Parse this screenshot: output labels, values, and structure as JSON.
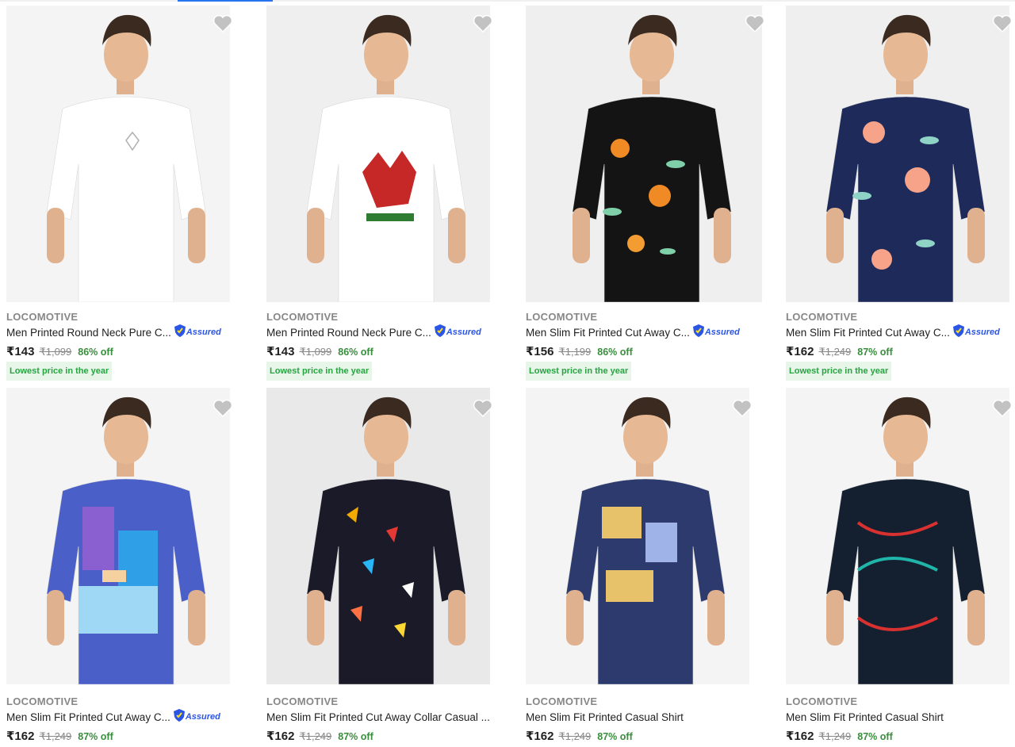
{
  "colors": {
    "accent": "#2874f0",
    "discount_green": "#388e3c",
    "badge_bg": "#e8f5e9",
    "assured_blue": "#2a55e5"
  },
  "assured_label": "Assured",
  "products": [
    {
      "brand": "LOCOMOTIVE",
      "title": "Men Printed Round Neck Pure C...",
      "assured": true,
      "price": "₹143",
      "mrp": "₹1,099",
      "discount": "86% off",
      "badge": "Lowest price in the year",
      "shirt_color": "#ffffff",
      "pattern": "plain-white",
      "bg": "#f4f4f4"
    },
    {
      "brand": "LOCOMOTIVE",
      "title": "Men Printed Round Neck Pure C...",
      "assured": true,
      "price": "₹143",
      "mrp": "₹1,099",
      "discount": "86% off",
      "badge": "Lowest price in the year",
      "shirt_color": "#ffffff",
      "pattern": "graphic-red",
      "bg": "#efefef"
    },
    {
      "brand": "LOCOMOTIVE",
      "title": "Men Slim Fit Printed Cut Away C...",
      "assured": true,
      "price": "₹156",
      "mrp": "₹1,199",
      "discount": "86% off",
      "badge": "Lowest price in the year",
      "shirt_color": "#141414",
      "pattern": "floral-orange",
      "bg": "#efefef"
    },
    {
      "brand": "LOCOMOTIVE",
      "title": "Men Slim Fit Printed Cut Away C...",
      "assured": true,
      "price": "₹162",
      "mrp": "₹1,249",
      "discount": "87% off",
      "badge": "Lowest price in the year",
      "shirt_color": "#1d2a5a",
      "pattern": "floral-pink",
      "bg": "#efefef"
    },
    {
      "brand": "LOCOMOTIVE",
      "title": "Men Slim Fit Printed Cut Away C...",
      "assured": true,
      "price": "₹162",
      "mrp": "₹1,249",
      "discount": "87% off",
      "badge": "",
      "shirt_color": "#4a5fc8",
      "pattern": "photo-blue",
      "bg": "#f4f4f4"
    },
    {
      "brand": "LOCOMOTIVE",
      "title": "Men Slim Fit Printed Cut Away Collar Casual ...",
      "assured": false,
      "price": "₹162",
      "mrp": "₹1,249",
      "discount": "87% off",
      "badge": "",
      "shirt_color": "#1a1a28",
      "pattern": "geometric",
      "bg": "#e9e9e9"
    },
    {
      "brand": "LOCOMOTIVE",
      "title": "Men Slim Fit Printed Casual Shirt",
      "assured": false,
      "price": "₹162",
      "mrp": "₹1,249",
      "discount": "87% off",
      "badge": "",
      "shirt_color": "#2c3a6e",
      "pattern": "abstract-yellow",
      "bg": "#f4f4f4"
    },
    {
      "brand": "LOCOMOTIVE",
      "title": "Men Slim Fit Printed Casual Shirt",
      "assured": false,
      "price": "₹162",
      "mrp": "₹1,249",
      "discount": "87% off",
      "badge": "",
      "shirt_color": "#142030",
      "pattern": "chain-red",
      "bg": "#f4f4f4"
    }
  ]
}
